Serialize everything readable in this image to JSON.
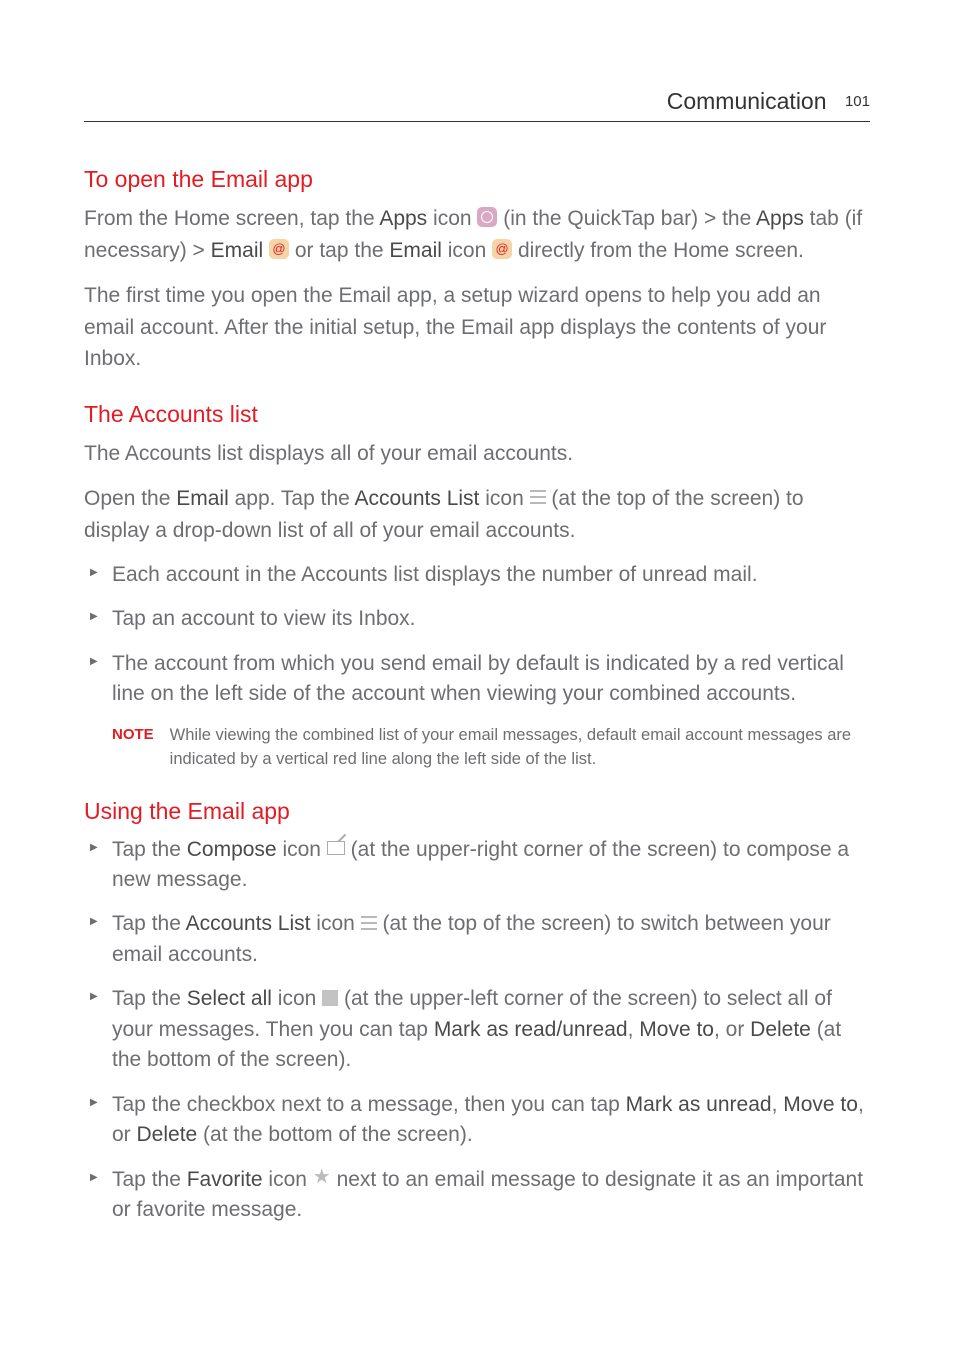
{
  "header": {
    "title": "Communication",
    "page": "101"
  },
  "sec1": {
    "heading": "To open the Email app",
    "p1": {
      "t1": "From the Home screen, tap the ",
      "b1": "Apps",
      "t2": " icon ",
      "t3": " (in the QuickTap bar) > the ",
      "b2": "Apps",
      "t4": " tab (if necessary) > ",
      "b3": "Email",
      "t5": " ",
      "t6": " or tap the ",
      "b4": "Email",
      "t7": " icon ",
      "t8": " directly from the Home screen."
    },
    "p2": "The first time you open the Email app, a setup wizard opens to help you add an email account. After the initial setup, the Email app displays the contents of your Inbox."
  },
  "sec2": {
    "heading": "The Accounts list",
    "p1": "The Accounts list displays all of your email accounts.",
    "p2": {
      "t1": "Open the ",
      "b1": "Email",
      "t2": " app. Tap the ",
      "b2": "Accounts List",
      "t3": " icon ",
      "t4": " (at the top of the screen) to display a drop-down list of all of your email accounts."
    },
    "li1": "Each account in the Accounts list displays the number of unread mail.",
    "li2": "Tap an account to view its Inbox.",
    "li3": "The account from which you send email by default is indicated by a red vertical line on the left side of the account when viewing your combined accounts.",
    "note_label": "NOTE",
    "note_text": "While viewing the combined list of your email messages, default email account messages are indicated by a vertical red line along the left side of the list."
  },
  "sec3": {
    "heading": "Using the Email app",
    "li1": {
      "t1": "Tap the ",
      "b1": "Compose",
      "t2": " icon ",
      "t3": " (at the upper-right corner of the screen) to compose a new message."
    },
    "li2": {
      "t1": "Tap the ",
      "b1": "Accounts List",
      "t2": " icon ",
      "t3": " (at the top of the screen) to switch between your email accounts."
    },
    "li3": {
      "t1": "Tap the ",
      "b1": "Select all",
      "t2": " icon ",
      "t3": " (at the upper-left corner of the screen) to select all of your messages. Then you can tap ",
      "b2": "Mark as read/unread",
      "t4": ", ",
      "b3": "Move to",
      "t5": ", or ",
      "b4": "Delete",
      "t6": " (at the bottom of the screen)."
    },
    "li4": {
      "t1": "Tap the checkbox next to a message, then you can tap ",
      "b1": "Mark as unread",
      "t2": ", ",
      "b2": "Move to",
      "t3": ", or ",
      "b3": "Delete",
      "t4": " (at the bottom of the screen)."
    },
    "li5": {
      "t1": "Tap the ",
      "b1": "Favorite",
      "t2": " icon ",
      "t3": " next to an email message to designate it as an important or favorite message."
    }
  }
}
